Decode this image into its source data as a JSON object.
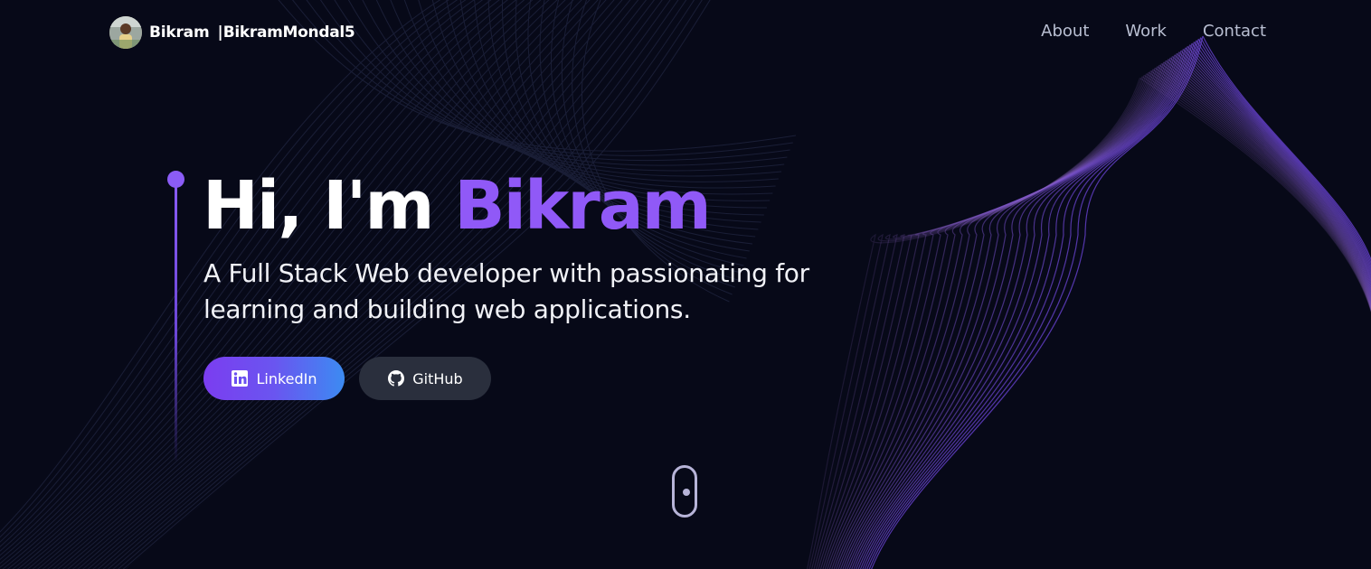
{
  "nav": {
    "brand_name": "Bikram",
    "brand_separator": "|",
    "brand_handle": "BikramMondal5",
    "links": [
      {
        "label": "About"
      },
      {
        "label": "Work"
      },
      {
        "label": "Contact"
      }
    ]
  },
  "hero": {
    "greeting": "Hi, I'm",
    "name": "Bikram",
    "subtitle": "A Full Stack Web developer with passionating for learning and building web applications.",
    "buttons": {
      "linkedin": {
        "label": "LinkedIn",
        "icon": "linkedin-icon"
      },
      "github": {
        "label": "GitHub",
        "icon": "github-icon"
      }
    }
  },
  "scroll_indicator": {
    "icon": "mouse-scroll-icon"
  },
  "colors": {
    "background": "#070918",
    "accent": "#9059f7",
    "nav_text": "#b9bfd2",
    "github_button": "#2a2f3d"
  }
}
